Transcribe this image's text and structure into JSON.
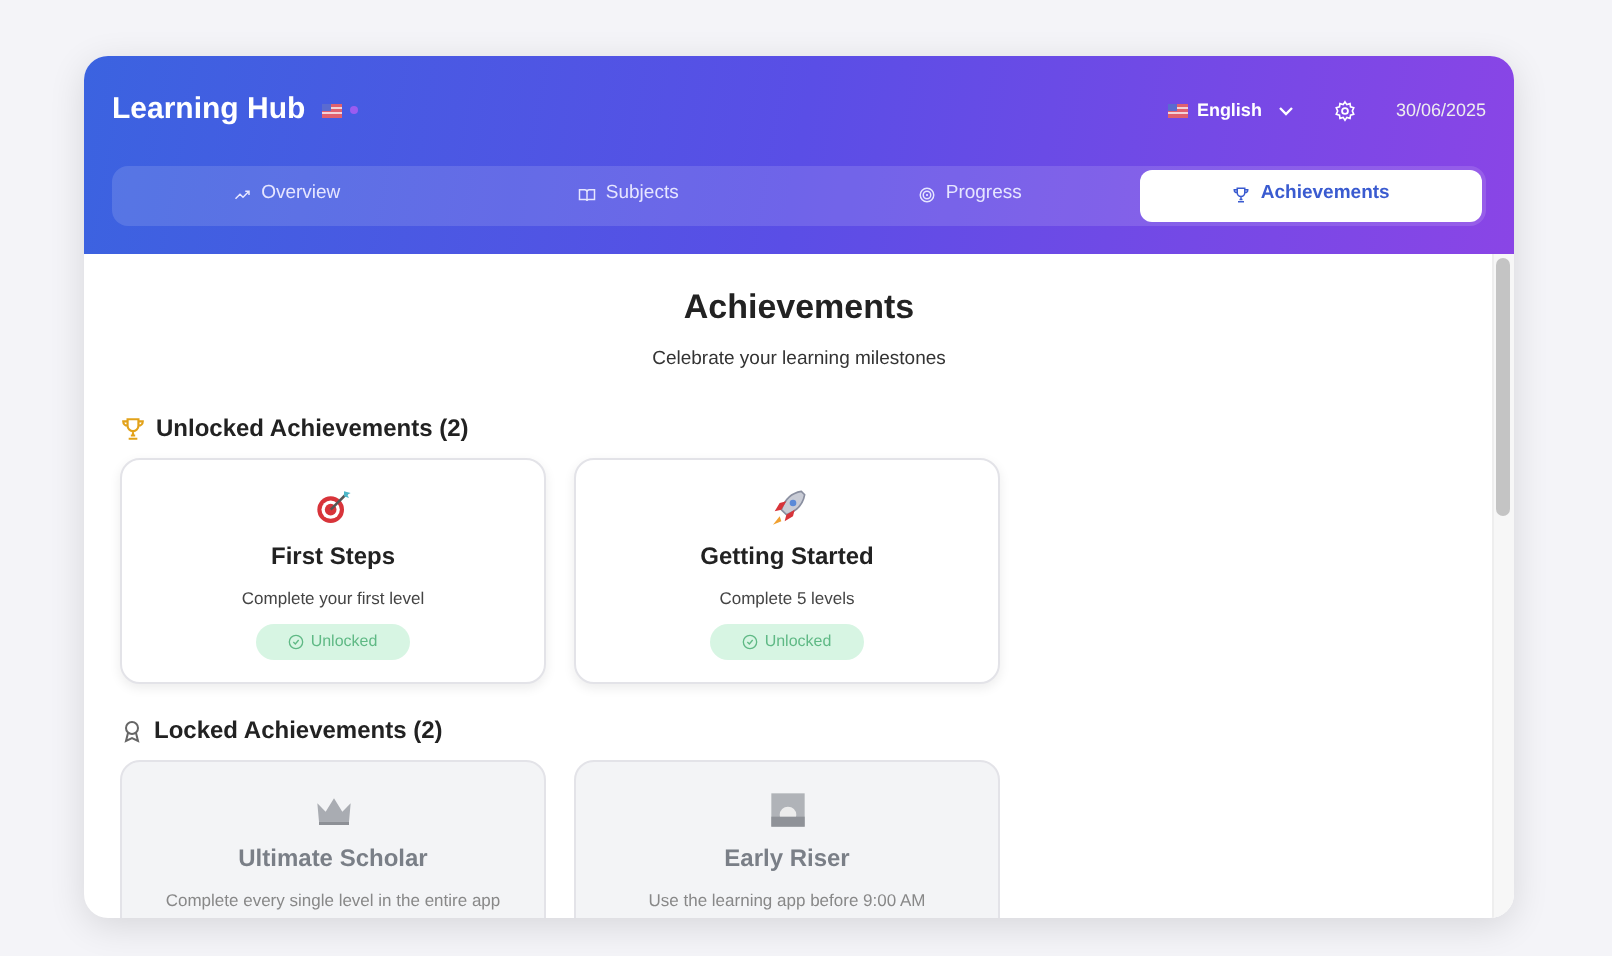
{
  "header": {
    "title": "Learning Hub",
    "language": "English",
    "date": "30/06/2025"
  },
  "tabs": [
    {
      "label": "Overview",
      "selected": false
    },
    {
      "label": "Subjects",
      "selected": false
    },
    {
      "label": "Progress",
      "selected": false
    },
    {
      "label": "Achievements",
      "selected": true
    }
  ],
  "page": {
    "title": "Achievements",
    "subtitle": "Celebrate your learning milestones"
  },
  "sections": [
    {
      "heading": "Unlocked Achievements (2)",
      "unlocked": true,
      "achievements": [
        {
          "title": "First Steps",
          "description": "Complete your first level",
          "badge": "Unlocked"
        },
        {
          "title": "Getting Started",
          "description": "Complete 5 levels",
          "badge": "Unlocked"
        }
      ]
    },
    {
      "heading": "Locked Achievements (2)",
      "unlocked": false,
      "achievements": [
        {
          "title": "Ultimate Scholar",
          "description": "Complete every single level in the entire app"
        },
        {
          "title": "Early Riser",
          "description": "Use the learning app before 9:00 AM"
        }
      ]
    }
  ]
}
